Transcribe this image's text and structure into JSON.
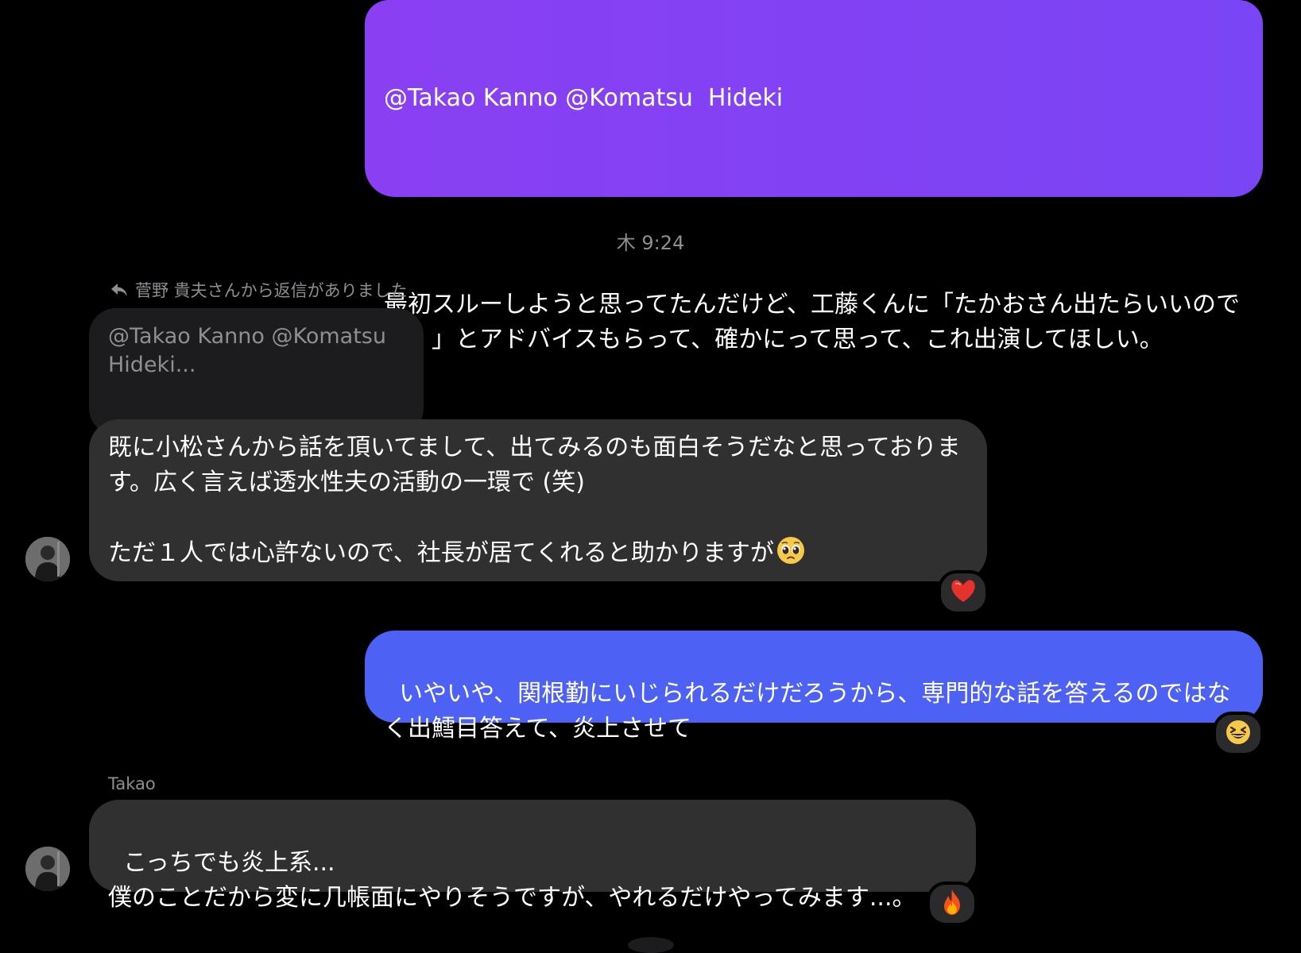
{
  "messages": {
    "out1": {
      "mentions": "@Takao Kanno @Komatsu  Hideki",
      "body": "最初スルーしようと思ってたんだけど、工藤くんに「たかおさん出たらいいのでは？」とアドバイスもらって、確かにって思って、これ出演してほしい。"
    },
    "timestamp": "木 9:24",
    "reply_note": "菅野 貴夫さんから返信がありました",
    "quoted_text": "@Takao Kanno @Komatsu Hideki...",
    "in1": {
      "body": "既に小松さんから話を頂いてまして、出てみるのも面白そうだなと思っております。広く言えば透水性夫の活動の一環で (笑)\n\nただ１人では心許ないので、社長が居てくれると助かりますが",
      "inline_emoji": "pleading-face",
      "reaction": "heart"
    },
    "out2": {
      "body": "いやいや、関根勤にいじられるだけだろうから、専門的な話を答えるのではなく出鱈目答えて、炎上させて",
      "reaction": "grinning-squinting-face"
    },
    "sender_name": "Takao",
    "in2": {
      "body": "こっちでも炎上系...\n僕のことだから変に几帳面にやりそうですが、やれるだけやってみます...。",
      "reaction": "fire"
    }
  },
  "colors": {
    "background": "#000000",
    "outgoing_purple": "#8a3ff3",
    "outgoing_blue": "#4e61f5",
    "incoming": "#303030",
    "muted_text": "#8e8e93"
  }
}
